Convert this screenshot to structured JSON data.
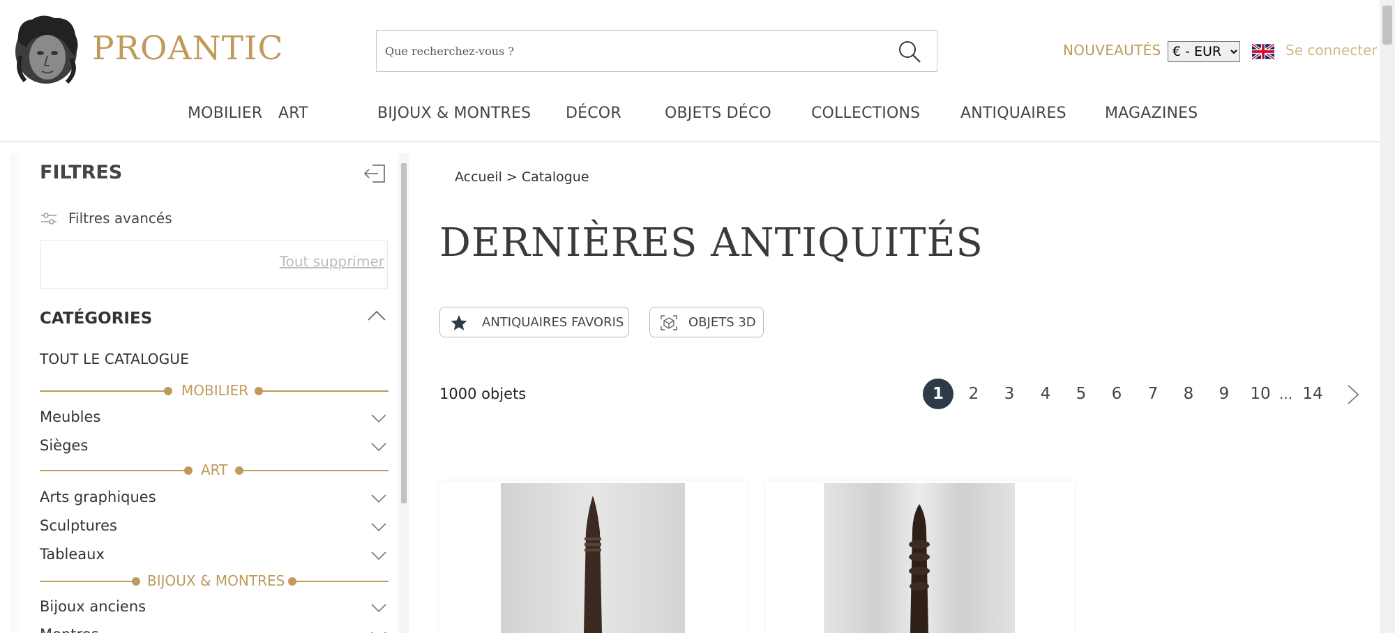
{
  "header": {
    "brand": "PROANTIC",
    "search_placeholder": "Que recherchez-vous ?",
    "nouveautes": "NOUVEAUTÉS",
    "currency": "€ - EUR",
    "login": "Se connecter"
  },
  "nav": [
    "MOBILIER",
    "ART",
    "BIJOUX & MONTRES",
    "DÉCOR",
    "OBJETS DÉCO",
    "COLLECTIONS",
    "ANTIQUAIRES",
    "MAGAZINES"
  ],
  "sidebar": {
    "title": "FILTRES",
    "advanced": "Filtres avancés",
    "clear_all": "Tout supprimer",
    "categories_title": "CATÉGORIES",
    "all_catalogue": "TOUT LE CATALOGUE",
    "sections": [
      {
        "label": "MOBILIER",
        "items": [
          "Meubles",
          "Sièges"
        ]
      },
      {
        "label": "ART",
        "items": [
          "Arts graphiques",
          "Sculptures",
          "Tableaux"
        ]
      },
      {
        "label": "BIJOUX & MONTRES",
        "items": [
          "Bijoux anciens",
          "Montres"
        ]
      }
    ]
  },
  "main": {
    "breadcrumb": "Accueil > Catalogue",
    "title": "DERNIÈRES ANTIQUITÉS",
    "pill_favoris": "ANTIQUAIRES FAVORIS",
    "pill_3d": "OBJETS 3D",
    "count": "1000 objets",
    "pages": [
      "1",
      "2",
      "3",
      "4",
      "5",
      "6",
      "7",
      "8",
      "9",
      "10"
    ],
    "ellipsis": "...",
    "last_page": "14",
    "current_page": 1
  },
  "colors": {
    "accent": "#bf9a5a",
    "active_page": "#2f3a48"
  }
}
